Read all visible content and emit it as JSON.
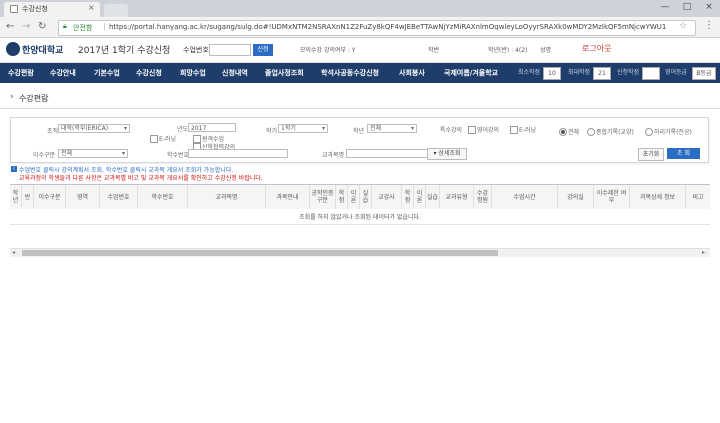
{
  "browser": {
    "tab_title": "수강신청",
    "tab_close": "×",
    "secure_label": "안전함",
    "url": "https://portal.hanyang.ac.kr/sugang/sulg.do#!UDMxNTM2NSRAXnN1Z2FuZy8kQF4wJEBeTTAwNjYzMiRAXnlmOqwleyLoOyyrSRAXk0wMDY2MzIkQF5mNjcwYWU1",
    "controls": [
      "—",
      "□",
      "×"
    ]
  },
  "header": {
    "logo_text": "한양대학교",
    "semester_title": "2017년 1학기 수강신청",
    "course_no_label": "수업번호",
    "course_no_value": "",
    "apply_button": "신청",
    "practice_label": "모의수강 강의여부 : Y",
    "student_id_label": "학번",
    "grade_label": "학년(반) : 4(2)",
    "name_label": "성명",
    "logout": "로그아웃"
  },
  "nav": {
    "items": [
      "수강편람",
      "수강안내",
      "기본수업",
      "수강신청",
      "희망수업",
      "신청내역",
      "졸업사정조회",
      "학석사공동수강신청",
      "사회봉사",
      "국제여름/겨울학교"
    ],
    "info": [
      {
        "label": "최소학점",
        "value": "10"
      },
      {
        "label": "최대학점",
        "value": "21"
      },
      {
        "label": "신청학점",
        "value": ""
      },
      {
        "label": "영어등급",
        "value": "B등급"
      }
    ]
  },
  "page_title": "수강편람",
  "filter": {
    "campus_label": "조직",
    "campus_value": "대학(학부(ERICA)",
    "year_label": "년도",
    "year_value": "2017",
    "semester_label": "학기",
    "semester_value": "1학기",
    "grade_label": "학년",
    "grade_value": "전체",
    "special_label": "특수강의",
    "special_opts": [
      "영어강의",
      "E-러닝"
    ],
    "sort_opts": [
      "전체",
      "종합기록(교양)",
      "하리기록(전공)"
    ],
    "row2_opts": [
      "E-러닝",
      "원격수업"
    ],
    "row3_opt": "산학협력강의",
    "type_label": "이수구분",
    "type_value": "전체",
    "course_no_label": "학수번호",
    "course_no_value": "",
    "course_name_label": "교과목명",
    "course_name_value": "",
    "detail_button": "▾ 상세조회",
    "reset_button": "초기화",
    "search_button": "조 회"
  },
  "notes": {
    "line1": "수업번호 클릭시 강의계획서 조회, 학수번호 클릭시 교과목 개요서 조회가 가능합니다.",
    "line2": "교육과정이 학생들과 다른 사항은 교과목별 비고 및 교과목 개요서를 확인하고 수강신청 바랍니다."
  },
  "table": {
    "headers": [
      "학년",
      "반",
      "이수구분",
      "영역",
      "수업번호",
      "학수번호",
      "교과목명",
      "과목안내",
      "공학인증 구분",
      "학점",
      "이론",
      "실습",
      "교강사",
      "학점",
      "이론",
      "실습",
      "교과유형",
      "수강 정원",
      "수업시간",
      "강의실",
      "이수제한 여부",
      "과목상세 정보",
      "비고"
    ],
    "empty_message": "조회를 하지 않았거나 조회된 데이터가 없습니다."
  },
  "colors": {
    "nav_bg": "#1f3d6b",
    "accent": "#2b6cc4",
    "secure": "#2e8b3c",
    "logout": "#c0392b",
    "note_red": "#d01010"
  }
}
